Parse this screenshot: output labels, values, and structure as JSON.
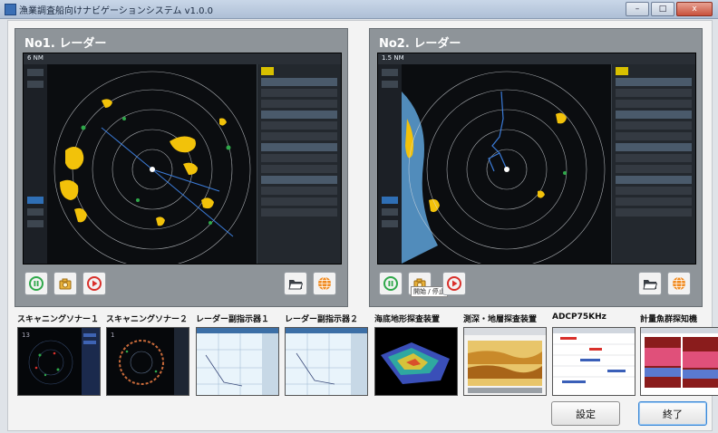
{
  "window": {
    "title": "漁業調査船向けナビゲーションシステム v1.0.0",
    "buttons": {
      "minimize": "–",
      "maximize": "□",
      "close": "x"
    }
  },
  "panels": [
    {
      "title": "No1. レーダー",
      "range": "6 NM"
    },
    {
      "title": "No2. レーダー",
      "range": "1.5 NM"
    }
  ],
  "tooltip": "開始 / 停止",
  "thumbnails": [
    {
      "label": "スキャニングソナー１"
    },
    {
      "label": "スキャニングソナー２"
    },
    {
      "label": "レーダー副指示器１"
    },
    {
      "label": "レーダー副指示器２"
    },
    {
      "label": "海底地形探査装置"
    },
    {
      "label": "測深・地層探査装置"
    },
    {
      "label": "ADCP75KHz"
    },
    {
      "label": "計量魚群探知機"
    }
  ],
  "actions": {
    "settings": "設定",
    "exit": "終了"
  },
  "colors": {
    "panel": "#8e9499",
    "radar_bg": "#111418",
    "echo": "#f2c20a",
    "rings": "#d9dde2",
    "record": "#d9302b",
    "play": "#2fa84a"
  },
  "icons": [
    "pause-icon",
    "camera-icon",
    "record-icon",
    "folder-icon",
    "globe-icon"
  ]
}
